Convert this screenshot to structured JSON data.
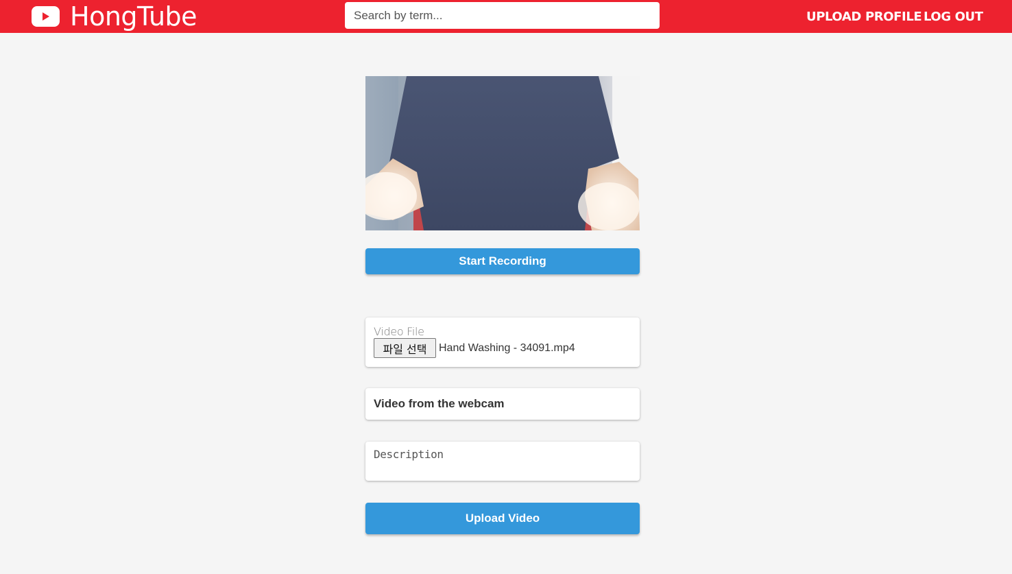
{
  "header": {
    "brand": "HongTube",
    "brand_color": "#ed222f",
    "logo_icon": "youtube-play-icon",
    "search_placeholder": "Search by term...",
    "nav": {
      "upload": "UPLOAD",
      "profile": "PROFILE",
      "logout": "LOG OUT"
    }
  },
  "recorder": {
    "preview_icon": "webcam-video-preview",
    "start_button": "Start Recording"
  },
  "form": {
    "file_label": "Video File",
    "file_button": "파일 선택",
    "file_name": "Hand Washing - 34091.mp4",
    "title_value": "Video from the webcam",
    "description_placeholder": "Description",
    "submit_label": "Upload Video",
    "accent_color": "#3498db"
  }
}
